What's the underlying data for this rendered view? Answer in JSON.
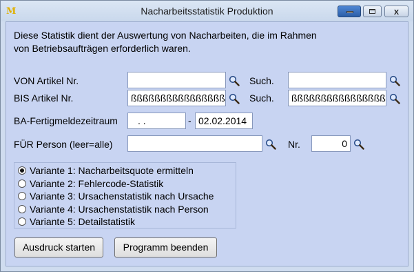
{
  "window": {
    "title": "Nacharbeitsstatistik Produktion",
    "app_icon": "M",
    "minimize_icon": "minimize-icon",
    "maximize_icon": "maximize-icon",
    "close_icon": "close-icon",
    "close_glyph": "x"
  },
  "description": {
    "line1": "Diese Statistik dient der Auswertung von Nacharbeiten, die im Rahmen",
    "line2": "von Betriebsaufträgen erforderlich waren."
  },
  "von": {
    "label": "VON Artikel Nr.",
    "value": "",
    "such_label": "Such.",
    "such_value": ""
  },
  "bis": {
    "label": "BIS Artikel Nr.",
    "value": "ßßßßßßßßßßßßßßßß",
    "such_label": "Such.",
    "such_value": "ßßßßßßßßßßßßßßßß"
  },
  "ba": {
    "label": "BA-Fertigmeldezeitraum",
    "from_value": ".  .",
    "separator": "-",
    "to_value": "02.02.2014"
  },
  "person": {
    "label": "FÜR Person (leer=alle)",
    "value": "",
    "nr_label": "Nr.",
    "nr_value": "0"
  },
  "variants": [
    {
      "label": "Variante 1: Nacharbeitsquote ermitteln",
      "selected": true
    },
    {
      "label": "Variante 2: Fehlercode-Statistik",
      "selected": false
    },
    {
      "label": "Variante 3: Ursachenstatistik nach Ursache",
      "selected": false
    },
    {
      "label": "Variante 4: Ursachenstatistik nach Person",
      "selected": false
    },
    {
      "label": "Variante 5: Detailstatistik",
      "selected": false
    }
  ],
  "buttons": {
    "start": "Ausdruck starten",
    "end": "Programm beenden"
  },
  "colors": {
    "client_bg": "#c8d4f2",
    "icon_accent": "#e0b000"
  }
}
